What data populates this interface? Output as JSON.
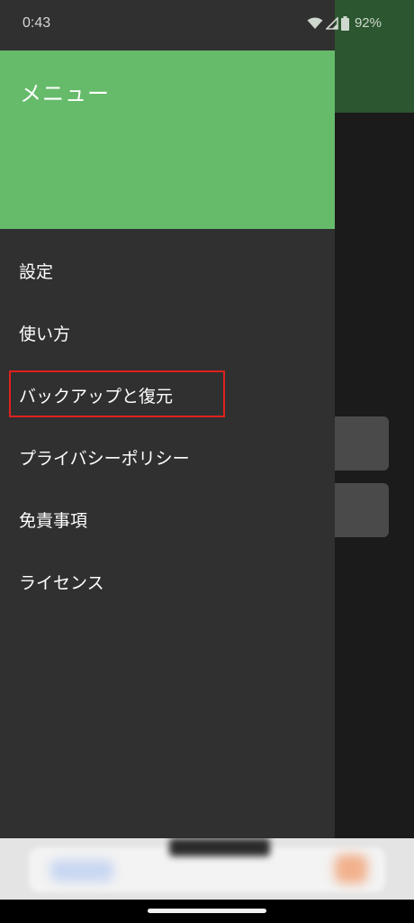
{
  "status_bar": {
    "time": "0:43",
    "battery_percent": "92%",
    "icons": [
      "wifi-icon",
      "cell-signal-icon",
      "battery-icon"
    ]
  },
  "drawer": {
    "title": "メニュー",
    "items": [
      {
        "label": "設定"
      },
      {
        "label": "使い方"
      },
      {
        "label": "バックアップと復元",
        "highlighted": true
      },
      {
        "label": "プライバシーポリシー"
      },
      {
        "label": "免責事項"
      },
      {
        "label": "ライセンス"
      }
    ]
  },
  "colors": {
    "header_green": "#66bb6a",
    "drawer_bg": "#303030",
    "highlight_red": "#e02020"
  }
}
